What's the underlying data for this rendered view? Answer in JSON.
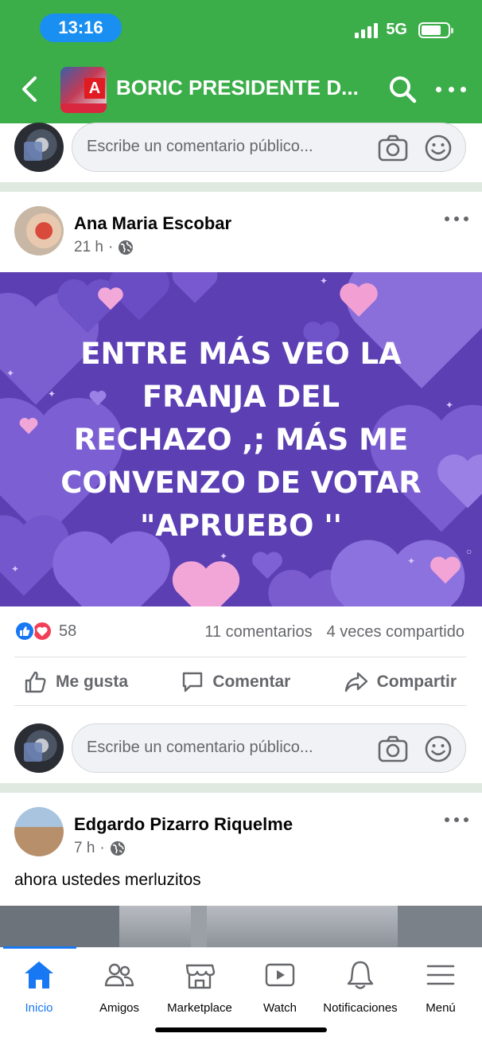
{
  "status_bar": {
    "time": "13:16",
    "network": "5G",
    "battery_level": 0.76
  },
  "header": {
    "title": "BORIC PRESIDENTE D...",
    "background_color": "#3bad49",
    "icons": [
      "back-arrow-icon",
      "search-icon",
      "more-icon"
    ]
  },
  "top_comment_box": {
    "placeholder": "Escribe un comentario público..."
  },
  "post1": {
    "author": "Ana Maria Escobar",
    "time": "21 h",
    "privacy_icon": "globe-icon",
    "card_text_lines": [
      "ENTRE MÁS VEO LA",
      "FRANJA DEL",
      "RECHAZO ,; MÁS ME",
      "CONVENZO DE  VOTAR",
      "\"APRUEBO ''"
    ],
    "card_background": "#5b3fb3",
    "reaction_count": "58",
    "reactions": [
      "like",
      "love"
    ],
    "comments": "11 comentarios",
    "shares": "4 veces compartido",
    "actions": {
      "like": "Me gusta",
      "comment": "Comentar",
      "share": "Compartir"
    },
    "comment_placeholder": "Escribe un comentario público..."
  },
  "post2": {
    "author": "Edgardo Pizarro Riquelme",
    "time": "7 h",
    "privacy_icon": "globe-icon",
    "text": "ahora ustedes merluzitos"
  },
  "bottom_nav": {
    "active_color": "#1877f2",
    "items": [
      {
        "label": "Inicio",
        "icon": "home-icon",
        "active": true
      },
      {
        "label": "Amigos",
        "icon": "friends-icon",
        "active": false
      },
      {
        "label": "Marketplace",
        "icon": "marketplace-icon",
        "active": false
      },
      {
        "label": "Watch",
        "icon": "watch-icon",
        "active": false
      },
      {
        "label": "Notificaciones",
        "icon": "bell-icon",
        "active": false
      },
      {
        "label": "Menú",
        "icon": "menu-icon",
        "active": false
      }
    ]
  }
}
